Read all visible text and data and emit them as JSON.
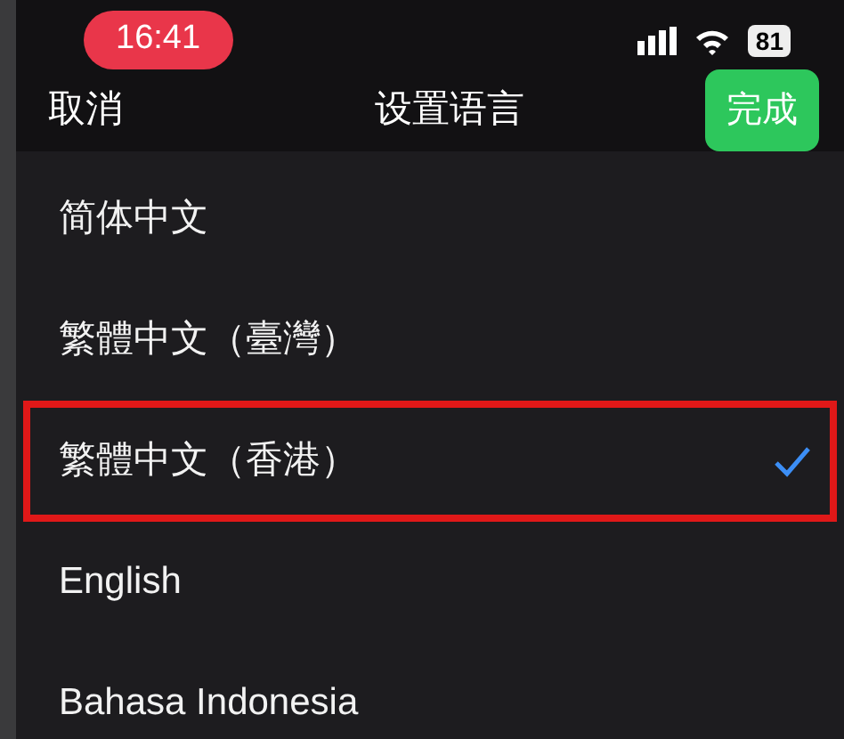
{
  "status_bar": {
    "time": "16:41",
    "battery": "81"
  },
  "nav": {
    "cancel": "取消",
    "title": "设置语言",
    "done": "完成"
  },
  "languages": [
    {
      "label": "简体中文",
      "selected": false,
      "highlighted": false
    },
    {
      "label": "繁體中文（臺灣）",
      "selected": false,
      "highlighted": false
    },
    {
      "label": "繁體中文（香港）",
      "selected": true,
      "highlighted": true
    },
    {
      "label": "English",
      "selected": false,
      "highlighted": false
    },
    {
      "label": "Bahasa Indonesia",
      "selected": false,
      "highlighted": false
    }
  ]
}
